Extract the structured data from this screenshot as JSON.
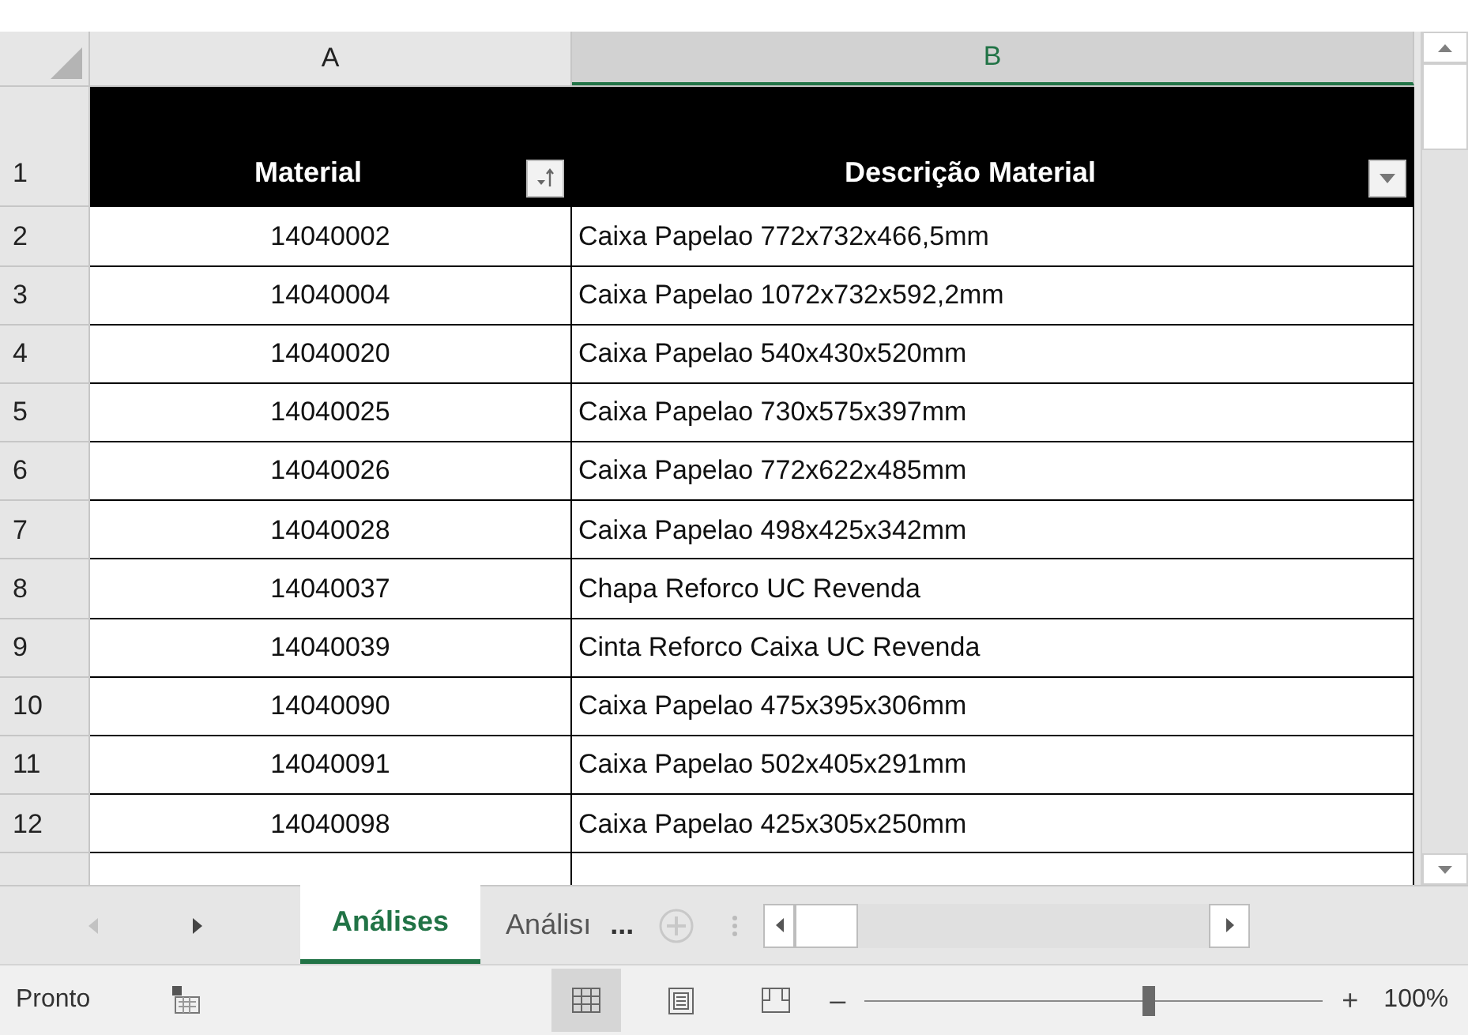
{
  "columns": [
    {
      "label": "A",
      "selected": false
    },
    {
      "label": "B",
      "selected": true
    }
  ],
  "header_row": {
    "number": "1",
    "cells": [
      {
        "text": "Material",
        "kind": "sorted"
      },
      {
        "text": "Descrição Material",
        "kind": "dropdown"
      }
    ]
  },
  "rows": [
    {
      "number": "2",
      "material": "14040002",
      "description": "Caixa Papelao 772x732x466,5mm"
    },
    {
      "number": "3",
      "material": "14040004",
      "description": "Caixa Papelao 1072x732x592,2mm"
    },
    {
      "number": "4",
      "material": "14040020",
      "description": "Caixa Papelao 540x430x520mm"
    },
    {
      "number": "5",
      "material": "14040025",
      "description": "Caixa Papelao 730x575x397mm"
    },
    {
      "number": "6",
      "material": "14040026",
      "description": "Caixa Papelao 772x622x485mm"
    },
    {
      "number": "7",
      "material": "14040028",
      "description": "Caixa Papelao 498x425x342mm"
    },
    {
      "number": "8",
      "material": "14040037",
      "description": "Chapa Reforco UC Revenda"
    },
    {
      "number": "9",
      "material": "14040039",
      "description": "Cinta Reforco Caixa UC Revenda"
    },
    {
      "number": "10",
      "material": "14040090",
      "description": "Caixa Papelao 475x395x306mm"
    },
    {
      "number": "11",
      "material": "14040091",
      "description": "Caixa Papelao 502x405x291mm"
    },
    {
      "number": "12",
      "material": "14040098",
      "description": "Caixa Papelao 425x305x250mm"
    }
  ],
  "sheet_tabs": [
    {
      "label": "Análises",
      "selected": true
    },
    {
      "label": "Análisı",
      "selected": false
    }
  ],
  "more_tabs": "...",
  "status_bar": {
    "text": "Pronto",
    "views": [
      {
        "kind": "normal",
        "selected": true
      },
      {
        "kind": "page_layout",
        "selected": false
      },
      {
        "kind": "page_break",
        "selected": false
      }
    ],
    "zoom": {
      "level": 0.62,
      "minus": "–",
      "plus": "+",
      "reading": "100%"
    }
  }
}
